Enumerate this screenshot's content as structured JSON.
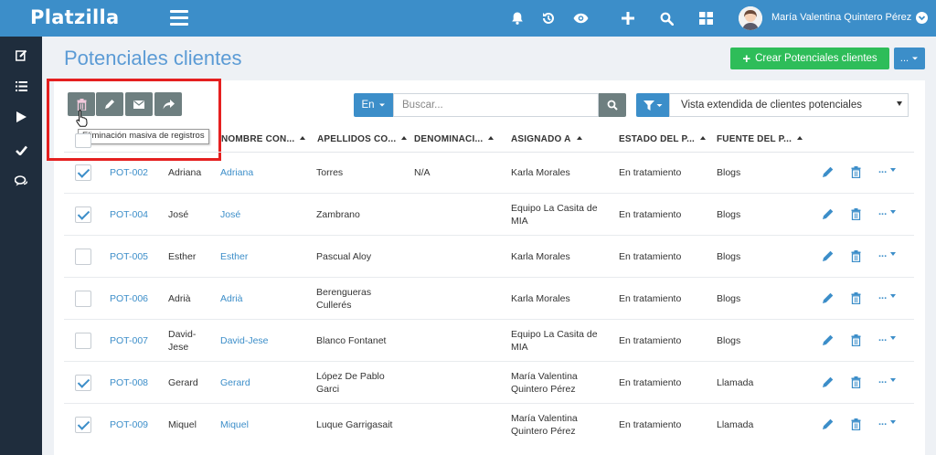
{
  "app": {
    "logo": "Platzilla",
    "user_name": "María Valentina Quintero Pérez"
  },
  "colors": {
    "primary": "#3c8ec9",
    "success": "#2ebd59",
    "sidebar": "#1f2d3d",
    "mass_button": "#6e7f80",
    "highlight": "#e52020"
  },
  "topbar_icons": [
    "bell-icon",
    "history-icon",
    "eye-icon",
    "plus-icon",
    "search-icon",
    "grid-icon"
  ],
  "sidebar_icons": [
    "edit-icon",
    "list-icon",
    "play-icon",
    "check-icon",
    "chat-icon"
  ],
  "page": {
    "title": "Potenciales clientes",
    "create_button": "Crear Potenciales clientes",
    "more_button": "..."
  },
  "toolbar": {
    "tooltip": "Eliminación masiva de registros",
    "search_scope": "En",
    "search_placeholder": "Buscar...",
    "view_select": "Vista extendida de clientes potenciales"
  },
  "table": {
    "headers": [
      "NOMBRE CON...",
      "APELLIDOS CO...",
      "DENOMINACI...",
      "ASIGNADO A",
      "ESTADO DEL P...",
      "FUENTE DEL P..."
    ],
    "rows": [
      {
        "checked": true,
        "id": "POT-002",
        "first": "Adriana",
        "contact": "Adriana",
        "surname": "Torres",
        "denom": "N/A",
        "assigned": "Karla Morales",
        "status": "En tratamiento",
        "source": "Blogs"
      },
      {
        "checked": true,
        "id": "POT-004",
        "first": "José",
        "contact": "José",
        "surname": "Zambrano",
        "denom": "",
        "assigned": "Equipo La Casita de MIA",
        "status": "En tratamiento",
        "source": "Blogs"
      },
      {
        "checked": false,
        "id": "POT-005",
        "first": "Esther",
        "contact": "Esther",
        "surname": "Pascual Aloy",
        "denom": "",
        "assigned": "Karla Morales",
        "status": "En tratamiento",
        "source": "Blogs"
      },
      {
        "checked": false,
        "id": "POT-006",
        "first": "Adrià",
        "contact": "Adrià",
        "surname": "Berengueras Cullerés",
        "denom": "",
        "assigned": "Karla Morales",
        "status": "En tratamiento",
        "source": "Blogs"
      },
      {
        "checked": false,
        "id": "POT-007",
        "first": "David-Jese",
        "contact": "David-Jese",
        "surname": "Blanco Fontanet",
        "denom": "",
        "assigned": "Equipo La Casita de MIA",
        "status": "En tratamiento",
        "source": "Blogs"
      },
      {
        "checked": true,
        "id": "POT-008",
        "first": "Gerard",
        "contact": "Gerard",
        "surname": "López De Pablo Garci",
        "denom": "",
        "assigned": "María Valentina Quintero Pérez",
        "status": "En tratamiento",
        "source": "Llamada"
      },
      {
        "checked": true,
        "id": "POT-009",
        "first": "Miquel",
        "contact": "Miquel",
        "surname": "Luque Garrigasait",
        "denom": "",
        "assigned": "María Valentina Quintero Pérez",
        "status": "En tratamiento",
        "source": "Llamada"
      }
    ],
    "row_more": "..."
  }
}
